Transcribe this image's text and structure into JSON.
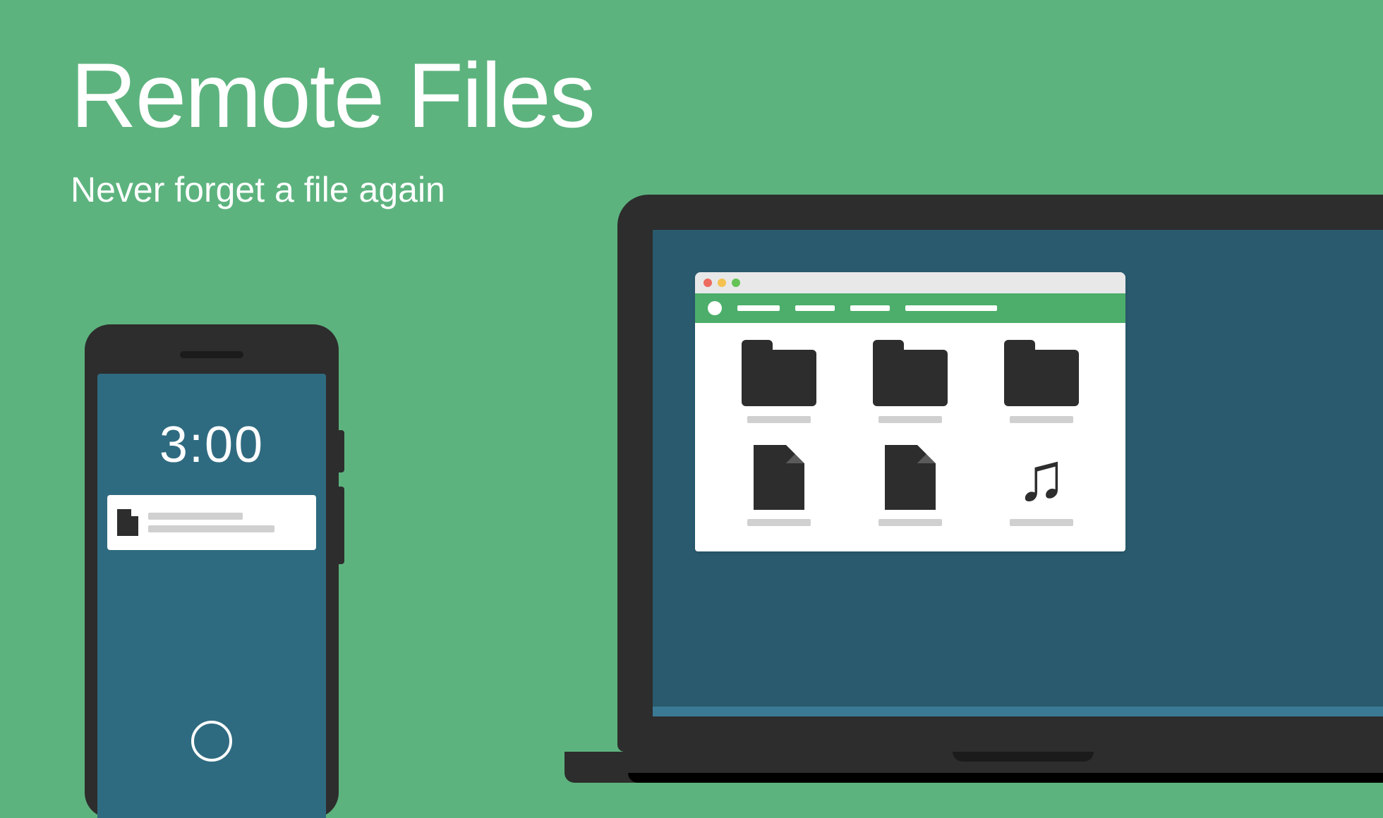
{
  "heading": {
    "title": "Remote Files",
    "subtitle": "Never forget a file again"
  },
  "phone": {
    "time": "3:00"
  },
  "window": {
    "traffic_lights": {
      "red": "#ed6a5e",
      "yellow": "#f5c250",
      "green": "#63c455"
    },
    "items": [
      {
        "type": "folder"
      },
      {
        "type": "folder"
      },
      {
        "type": "folder"
      },
      {
        "type": "file"
      },
      {
        "type": "file"
      },
      {
        "type": "music"
      }
    ]
  },
  "colors": {
    "background": "#5db37e",
    "toolbar": "#4cae6a",
    "screen_phone": "#2f6b80",
    "screen_laptop": "#2a5a6e"
  }
}
